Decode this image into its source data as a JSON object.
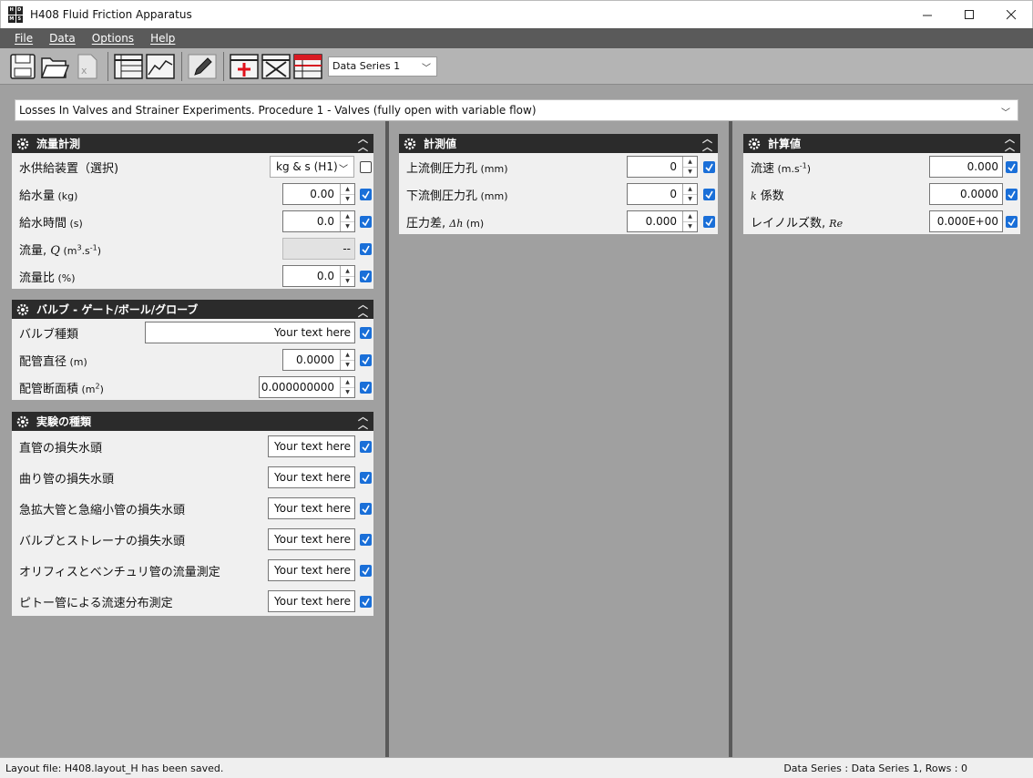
{
  "window": {
    "title": "H408 Fluid Friction Apparatus",
    "logo_letters": [
      "H",
      "D",
      "M",
      "S"
    ]
  },
  "menu": [
    "File",
    "Data",
    "Options",
    "Help"
  ],
  "toolbar": {
    "series_select": "Data Series 1"
  },
  "procedure": "Losses In Valves and Strainer Experiments. Procedure 1 - Valves (fully open with variable flow)",
  "flow_panel": {
    "title": "流量計測",
    "rows": [
      {
        "label": "水供給装置（選択)",
        "value": "kg & s (H1)"
      },
      {
        "label": "給水量",
        "unit": " (kg)",
        "value": "0.00"
      },
      {
        "label": "給水時間",
        "unit": " (s)",
        "value": "0.0"
      },
      {
        "label": "流量,",
        "symbol": "Q",
        "unit_pre": " (m",
        "unit_sup": "3",
        "unit_mid": ".s",
        "unit_sup2": "-1",
        "unit_post": ")",
        "value": "--"
      },
      {
        "label": "流量比",
        "unit": " (%)",
        "value": "0.0"
      }
    ]
  },
  "valve_panel": {
    "title": "バルブ - ゲート/ボール/グローブ",
    "rows": [
      {
        "label": "バルブ種類",
        "value": "Your text here"
      },
      {
        "label": "配管直径",
        "unit": " (m)",
        "value": "0.0000"
      },
      {
        "label": "配管断面積",
        "unit_pre": " (m",
        "unit_sup": "2",
        "unit_post": ")",
        "value": "0.000000000"
      }
    ]
  },
  "experiment_panel": {
    "title": "実験の種類",
    "rows": [
      {
        "label": "直管の損失水頭",
        "value": "Your text here"
      },
      {
        "label": "曲り管の損失水頭",
        "value": "Your text here"
      },
      {
        "label": "急拡大管と急縮小管の損失水頭",
        "value": "Your text here"
      },
      {
        "label": "バルブとストレーナの損失水頭",
        "value": "Your text here"
      },
      {
        "label": "オリフィスとベンチュリ管の流量測定",
        "value": "Your text here"
      },
      {
        "label": "ピトー管による流速分布測定",
        "value": "Your text here"
      }
    ]
  },
  "measured_panel": {
    "title": "計測値",
    "rows": [
      {
        "label": "上流側圧力孔",
        "unit": " (mm)",
        "value": "0"
      },
      {
        "label": "下流側圧力孔",
        "unit": " (mm)",
        "value": "0"
      },
      {
        "label": "圧力差,",
        "symbol": "Δh",
        "unit": " (m)",
        "value": "0.000"
      }
    ]
  },
  "calc_panel": {
    "title": "計算値",
    "rows": [
      {
        "label": "流速",
        "unit_pre": " (m.s",
        "unit_sup": "-1",
        "unit_post": ")",
        "value": "0.000"
      },
      {
        "symbol": "k",
        "label": " 係数",
        "value": "0.0000"
      },
      {
        "label": "レイノルズ数,",
        "symbol": "Re",
        "value": "0.000E+00"
      }
    ]
  },
  "status": {
    "left": "Layout file: H408.layout_H has been saved.",
    "right": "Data Series : Data Series 1,  Rows : 0"
  }
}
